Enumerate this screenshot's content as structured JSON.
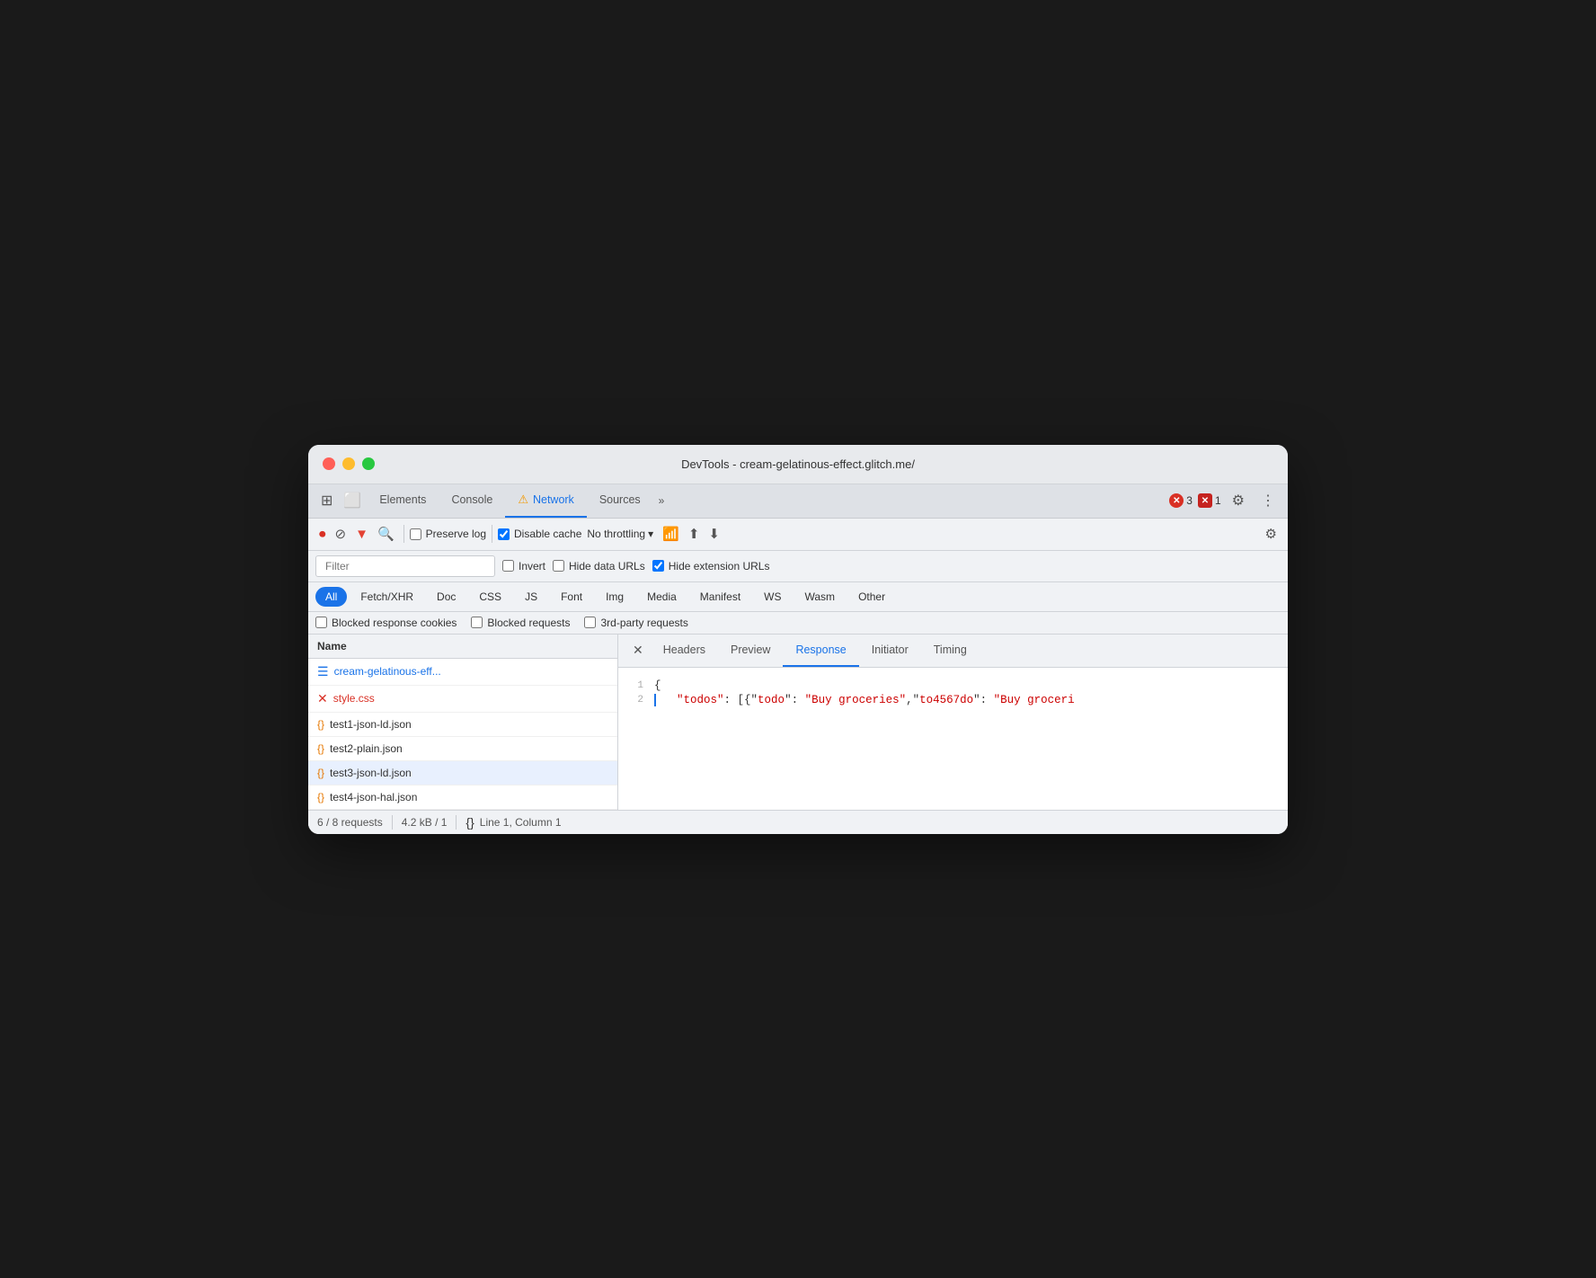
{
  "window": {
    "title": "DevTools - cream-gelatinous-effect.glitch.me/"
  },
  "tabs": [
    {
      "id": "elements",
      "label": "Elements",
      "active": false
    },
    {
      "id": "console",
      "label": "Console",
      "active": false
    },
    {
      "id": "network",
      "label": "Network",
      "active": true,
      "warning": true
    },
    {
      "id": "sources",
      "label": "Sources",
      "active": false
    }
  ],
  "errors": {
    "red_count": "3",
    "pink_count": "1"
  },
  "controls": {
    "preserve_log": "Preserve log",
    "disable_cache": "Disable cache",
    "throttle": "No throttling",
    "filter_placeholder": "Filter",
    "invert": "Invert",
    "hide_data_urls": "Hide data URLs",
    "hide_ext_urls": "Hide extension URLs"
  },
  "type_filters": [
    {
      "id": "all",
      "label": "All",
      "active": true
    },
    {
      "id": "fetch",
      "label": "Fetch/XHR",
      "active": false
    },
    {
      "id": "doc",
      "label": "Doc",
      "active": false
    },
    {
      "id": "css",
      "label": "CSS",
      "active": false
    },
    {
      "id": "js",
      "label": "JS",
      "active": false
    },
    {
      "id": "font",
      "label": "Font",
      "active": false
    },
    {
      "id": "img",
      "label": "Img",
      "active": false
    },
    {
      "id": "media",
      "label": "Media",
      "active": false
    },
    {
      "id": "manifest",
      "label": "Manifest",
      "active": false
    },
    {
      "id": "ws",
      "label": "WS",
      "active": false
    },
    {
      "id": "wasm",
      "label": "Wasm",
      "active": false
    },
    {
      "id": "other",
      "label": "Other",
      "active": false
    }
  ],
  "extra_filters": [
    {
      "id": "blocked_cookies",
      "label": "Blocked response cookies"
    },
    {
      "id": "blocked_requests",
      "label": "Blocked requests"
    },
    {
      "id": "third_party",
      "label": "3rd-party requests"
    }
  ],
  "file_list": {
    "header": "Name",
    "items": [
      {
        "id": "main",
        "icon": "doc",
        "name": "cream-gelatinous-eff...",
        "selected": false
      },
      {
        "id": "css",
        "icon": "err",
        "name": "style.css",
        "selected": false
      },
      {
        "id": "json1",
        "icon": "json",
        "name": "test1-json-ld.json",
        "selected": false
      },
      {
        "id": "json2",
        "icon": "json",
        "name": "test2-plain.json",
        "selected": false
      },
      {
        "id": "json3",
        "icon": "json",
        "name": "test3-json-ld.json",
        "selected": true
      },
      {
        "id": "json4",
        "icon": "json",
        "name": "test4-json-hal.json",
        "selected": false
      }
    ]
  },
  "panel_tabs": [
    {
      "id": "headers",
      "label": "Headers",
      "active": false
    },
    {
      "id": "preview",
      "label": "Preview",
      "active": false
    },
    {
      "id": "response",
      "label": "Response",
      "active": true
    },
    {
      "id": "initiator",
      "label": "Initiator",
      "active": false
    },
    {
      "id": "timing",
      "label": "Timing",
      "active": false
    }
  ],
  "response_code": [
    {
      "line": 1,
      "content": "{",
      "type": "plain"
    },
    {
      "line": 2,
      "content": "  \"todos\": [{\"todo\": \"Buy groceries\",\"to4567do\": \"Buy groceri",
      "type": "data",
      "has_bar": true
    }
  ],
  "status_bar": {
    "requests": "6 / 8 requests",
    "size": "4.2 kB / 1",
    "position": "Line 1, Column 1"
  }
}
